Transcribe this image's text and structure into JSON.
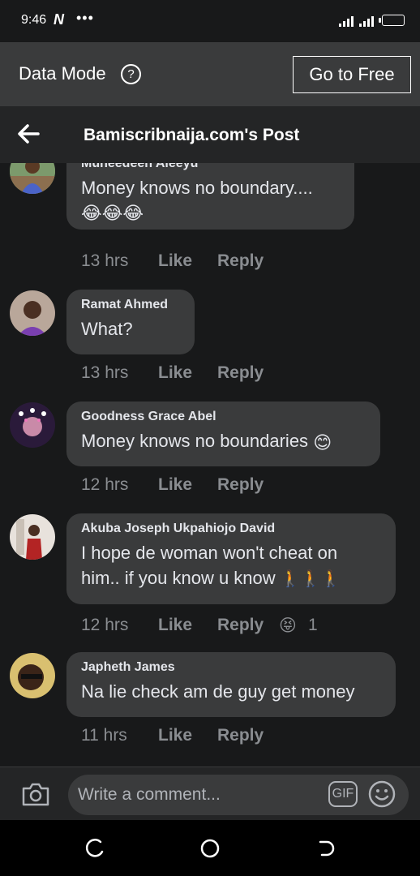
{
  "status_bar": {
    "time": "9:46",
    "n_badge": "N",
    "dots": "•••"
  },
  "data_mode": {
    "label": "Data Mode",
    "help": "?",
    "free_button": "Go to Free"
  },
  "header": {
    "title": "Bamiscribnaija.com's Post"
  },
  "comments": [
    {
      "name": "Muheedeen Aleeyu",
      "text": "Money knows no boundary....",
      "emoji_line": "😂😂😂",
      "time": "13 hrs",
      "like": "Like",
      "reply": "Reply"
    },
    {
      "name": "Ramat Ahmed",
      "text": "What?",
      "time": "13 hrs",
      "like": "Like",
      "reply": "Reply"
    },
    {
      "name": "Goodness Grace Abel",
      "text": "Money knows no boundaries",
      "emoji": "😊",
      "time": "12 hrs",
      "like": "Like",
      "reply": "Reply"
    },
    {
      "name": "Akuba Joseph Ukpahiojo David",
      "text_line1": "I hope de woman won't cheat on",
      "text_line2": "him.. if you know u know",
      "emoji": "🚶🚶🚶",
      "time": "12 hrs",
      "like": "Like",
      "reply": "Reply",
      "reaction_emoji": "😝",
      "reaction_count": "1"
    },
    {
      "name": "Japheth James",
      "text": "Na lie check am de guy get money",
      "time": "11 hrs",
      "like": "Like",
      "reply": "Reply"
    }
  ],
  "composer": {
    "placeholder": "Write a comment...",
    "gif": "GIF"
  },
  "icons": {
    "back": "arrow-left-icon",
    "help": "question-circle-icon",
    "camera": "camera-icon",
    "gif": "gif-icon",
    "emoji": "smiley-icon",
    "nav_recent": "recent-apps-icon",
    "nav_home": "home-circle-icon",
    "nav_back": "back-nav-icon"
  },
  "colors": {
    "background": "#18191a",
    "bubble": "#3a3b3c",
    "header": "#242526",
    "meta_text": "#8a8d91"
  }
}
